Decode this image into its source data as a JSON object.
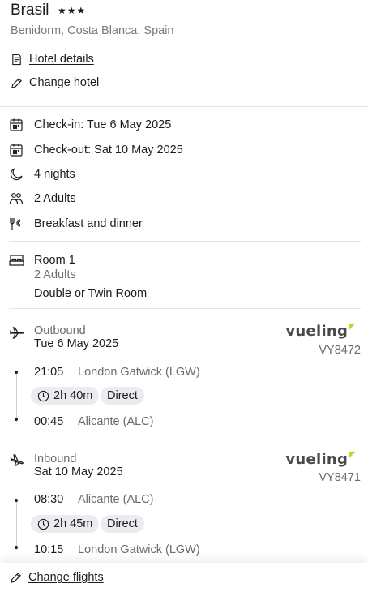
{
  "hotel": {
    "name": "Brasil",
    "stars": "★★★",
    "location": "Benidorm, Costa Blanca, Spain",
    "details_link": "Hotel details",
    "change_link": "Change hotel"
  },
  "stay": {
    "checkin": "Check-in: Tue 6 May 2025",
    "checkout": "Check-out: Sat 10 May 2025",
    "nights": "4 nights",
    "guests": "2 Adults",
    "board": "Breakfast and dinner"
  },
  "room": {
    "title": "Room 1",
    "guests": "2 Adults",
    "type": "Double or Twin Room"
  },
  "flights": {
    "outbound": {
      "label": "Outbound",
      "date": "Tue 6 May 2025",
      "airline": "vueling",
      "flight_no": "VY8472",
      "depart_time": "21:05",
      "depart_airport": "London Gatwick (LGW)",
      "duration": "2h 40m",
      "stops": "Direct",
      "arrive_time": "00:45",
      "arrive_airport": "Alicante (ALC)"
    },
    "inbound": {
      "label": "Inbound",
      "date": "Sat 10 May 2025",
      "airline": "vueling",
      "flight_no": "VY8471",
      "depart_time": "08:30",
      "depart_airport": "Alicante (ALC)",
      "duration": "2h 45m",
      "stops": "Direct",
      "arrive_time": "10:15",
      "arrive_airport": "London Gatwick (LGW)"
    },
    "change_link": "Change flights"
  },
  "colors": {
    "text": "#1c1c1c",
    "muted": "#6b6b6b",
    "pill_bg": "#ececf0",
    "divider": "#e4e4e4",
    "airline_accent": "#cccc33"
  },
  "icons": {
    "details": "document-icon",
    "change": "pencil-icon",
    "calendar": "calendar-icon",
    "nights": "moon-icon",
    "guests": "people-icon",
    "board": "cutlery-icon",
    "room": "bed-icon",
    "outbound": "plane-departure-icon",
    "inbound": "plane-arrival-icon",
    "duration": "clock-icon"
  }
}
